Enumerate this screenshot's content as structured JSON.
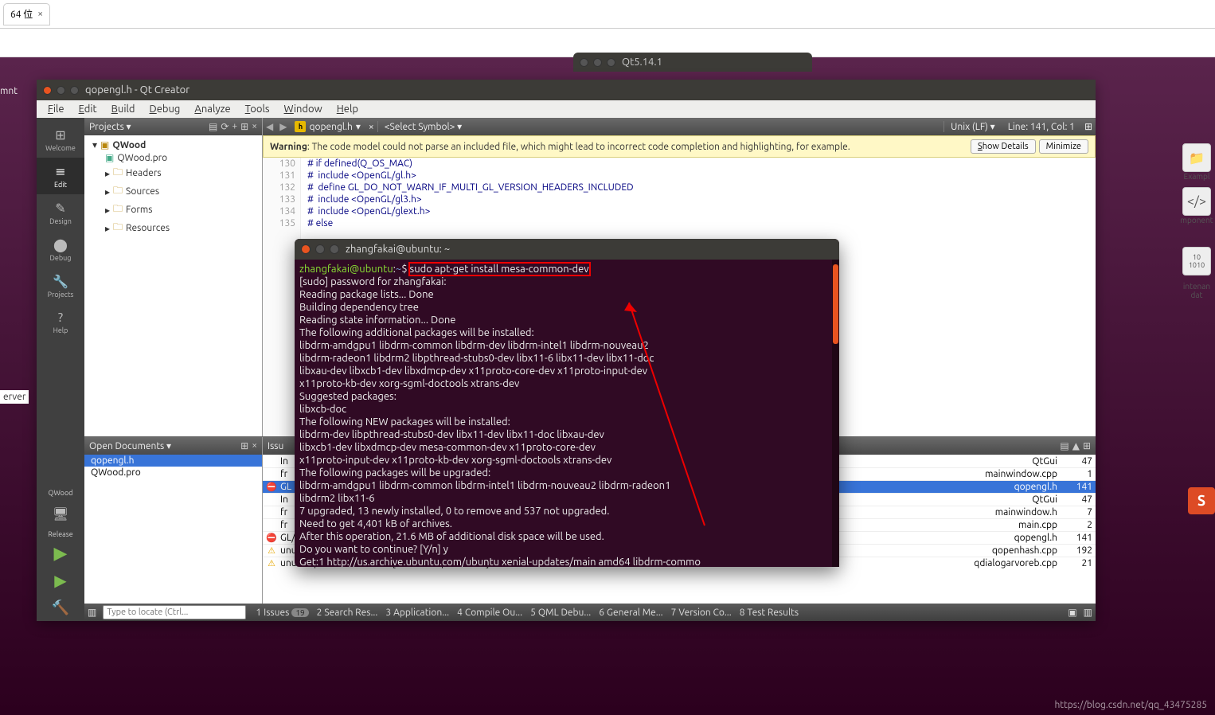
{
  "browser": {
    "tab_label": "64 位",
    "tab_close": "×"
  },
  "bg_window_title": "Qt5.14.1",
  "launcher": {
    "examples": "Exampl",
    "component": "mponent",
    "intenan": "intenan",
    "dat": "dat"
  },
  "qtcreator": {
    "title": "qopengl.h - Qt Creator",
    "menu": [
      "File",
      "Edit",
      "Build",
      "Debug",
      "Analyze",
      "Tools",
      "Window",
      "Help"
    ],
    "sidebar": [
      {
        "label": "Welcome",
        "icon": "⊞"
      },
      {
        "label": "Edit",
        "icon": "≡"
      },
      {
        "label": "Design",
        "icon": "✎"
      },
      {
        "label": "Debug",
        "icon": "⬤"
      },
      {
        "label": "Projects",
        "icon": "🔧"
      },
      {
        "label": "Help",
        "icon": "?"
      }
    ],
    "sidebar_project": "QWood",
    "sidebar_release": "Release",
    "projects": {
      "header": "Projects",
      "root": "QWood",
      "pro": "QWood.pro",
      "folders": [
        "Headers",
        "Sources",
        "Forms",
        "Resources"
      ]
    },
    "editor": {
      "file": "qopengl.h",
      "symbol": "<Select Symbol>",
      "encoding": "Unix (LF)",
      "linecol": "Line: 141, Col: 1",
      "warning_label": "Warning",
      "warning_text": ": The code model could not parse an included file, which might lead to incorrect code completion and highlighting, for example.",
      "show_details": "Show Details",
      "minimize": "Minimize",
      "lines": [
        {
          "n": 130,
          "t": "# if defined(Q_OS_MAC)"
        },
        {
          "n": 131,
          "t": "#  include <OpenGL/gl.h>"
        },
        {
          "n": 132,
          "t": "#  define GL_DO_NOT_WARN_IF_MULTI_GL_VERSION_HEADERS_INCLUDED"
        },
        {
          "n": 133,
          "t": "#  include <OpenGL/gl3.h>"
        },
        {
          "n": 134,
          "t": "#  include <OpenGL/glext.h>"
        },
        {
          "n": 135,
          "t": "# else"
        }
      ]
    },
    "opendocs": {
      "header": "Open Documents",
      "items": [
        "qopengl.h",
        "QWood.pro"
      ]
    },
    "issues": {
      "header": "Issu",
      "rows": [
        {
          "icon": "",
          "text": "In",
          "file": "QtGui",
          "line": 47
        },
        {
          "icon": "",
          "text": "fr",
          "file": "mainwindow.cpp",
          "line": 1
        },
        {
          "icon": "err",
          "text": "GL",
          "file": "qopengl.h",
          "line": 141,
          "sel": true
        },
        {
          "icon": "",
          "text": "In",
          "file": "QtGui",
          "line": 47
        },
        {
          "icon": "",
          "text": "fr",
          "file": "mainwindow.h",
          "line": 7
        },
        {
          "icon": "",
          "text": "fr",
          "file": "main.cpp",
          "line": 2
        },
        {
          "icon": "err",
          "text": "GL/gl.h: No such file or directory",
          "file": "qopengl.h",
          "line": 141
        },
        {
          "icon": "warn",
          "text": "unused parameter 'tipo' [-Wunused-parameter]",
          "file": "qopenhash.cpp",
          "line": 192
        },
        {
          "icon": "warn",
          "text": "unused parameter 'event' [-Wunused-parameter]",
          "file": "qdialogarvoreb.cpp",
          "line": 21
        }
      ]
    },
    "status": {
      "locator_placeholder": "Type to locate (Ctrl...",
      "items": [
        {
          "n": "1",
          "label": "Issues",
          "badge": "19"
        },
        {
          "n": "2",
          "label": "Search Res..."
        },
        {
          "n": "3",
          "label": "Application..."
        },
        {
          "n": "4",
          "label": "Compile Ou..."
        },
        {
          "n": "5",
          "label": "QML Debu..."
        },
        {
          "n": "6",
          "label": "General Me..."
        },
        {
          "n": "7",
          "label": "Version Co..."
        },
        {
          "n": "8",
          "label": "Test Results"
        }
      ]
    }
  },
  "terminal": {
    "title": "zhangfakai@ubuntu: ~",
    "prompt_user": "zhangfakai@ubuntu",
    "prompt_path": "~",
    "command": "sudo apt-get install mesa-common-dev",
    "lines": [
      "[sudo] password for zhangfakai:",
      "Reading package lists... Done",
      "Building dependency tree",
      "Reading state information... Done",
      "The following additional packages will be installed:",
      "  libdrm-amdgpu1 libdrm-common libdrm-dev libdrm-intel1 libdrm-nouveau2",
      "  libdrm-radeon1 libdrm2 libpthread-stubs0-dev libx11-6 libx11-dev libx11-doc",
      "  libxau-dev libxcb1-dev libxdmcp-dev x11proto-core-dev x11proto-input-dev",
      "  x11proto-kb-dev xorg-sgml-doctools xtrans-dev",
      "Suggested packages:",
      "  libxcb-doc",
      "The following NEW packages will be installed:",
      "  libdrm-dev libpthread-stubs0-dev libx11-dev libx11-doc libxau-dev",
      "  libxcb1-dev libxdmcp-dev mesa-common-dev x11proto-core-dev",
      "  x11proto-input-dev x11proto-kb-dev xorg-sgml-doctools xtrans-dev",
      "The following packages will be upgraded:",
      "  libdrm-amdgpu1 libdrm-common libdrm-intel1 libdrm-nouveau2 libdrm-radeon1",
      "  libdrm2 libx11-6",
      "7 upgraded, 13 newly installed, 0 to remove and 537 not upgraded.",
      "Need to get 4,401 kB of archives.",
      "After this operation, 21.6 MB of additional disk space will be used.",
      "Do you want to continue? [Y/n] y",
      "Get:1 http://us.archive.ubuntu.com/ubuntu xenial-updates/main amd64 libdrm-commo"
    ]
  },
  "watermark": "https://blog.csdn.net/qq_43475285",
  "server_label": "erver",
  "mnt_label": "mnt"
}
